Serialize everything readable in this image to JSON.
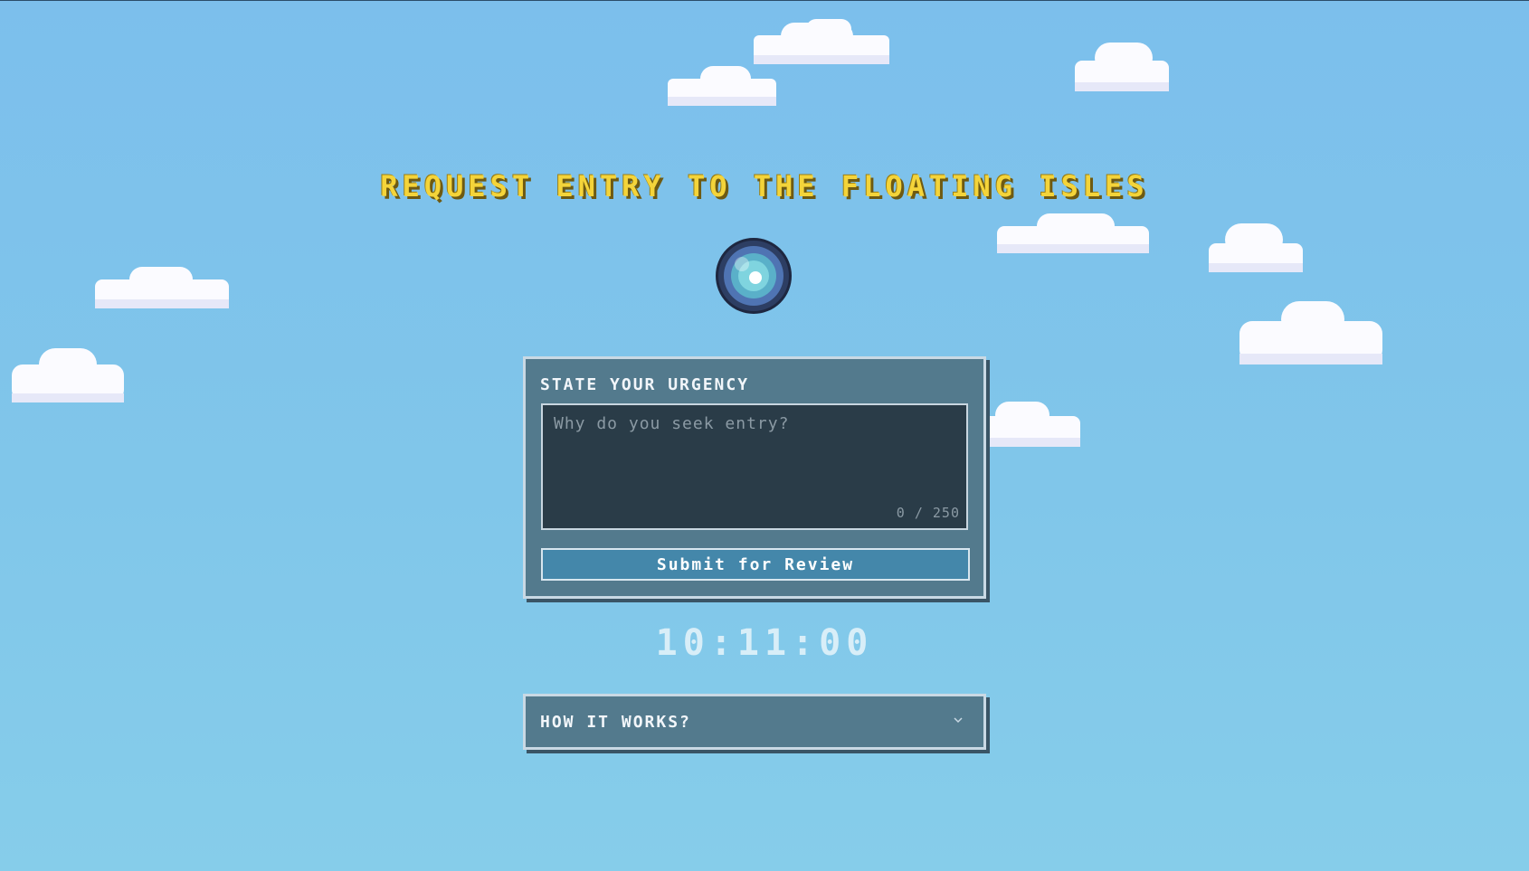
{
  "header": {
    "title": "REQUEST ENTRY TO THE FLOATING ISLES"
  },
  "urgency_form": {
    "label": "STATE YOUR URGENCY",
    "placeholder": "Why do you seek entry?",
    "value": "",
    "char_count": "0 / 250",
    "submit_label": "Submit for Review"
  },
  "countdown": {
    "text": "10:11:00"
  },
  "how_it_works": {
    "label": "HOW IT WORKS?",
    "expanded": false
  },
  "colors": {
    "sky": "#7cbfec",
    "title": "#f4d43a",
    "panel": "#537a8d",
    "textarea": "#2a3c48",
    "button": "#4487aa"
  },
  "icons": {
    "orb": "glowing-orb-icon",
    "chevron": "chevron-down-icon"
  }
}
